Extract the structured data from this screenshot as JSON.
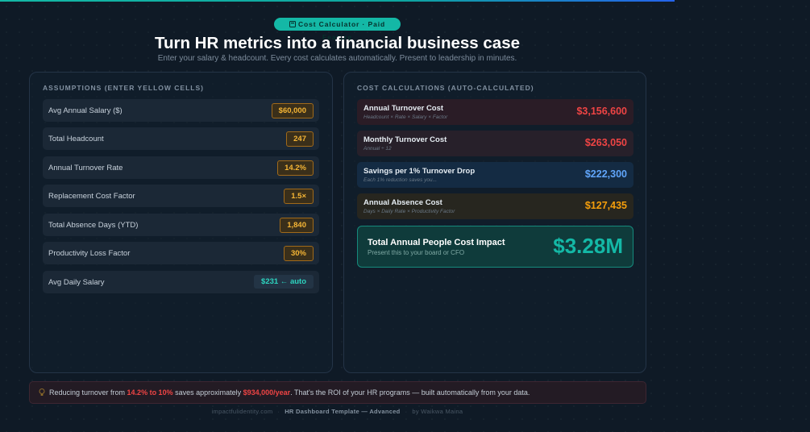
{
  "badge": {
    "icon": "calculator-icon",
    "label": "Cost Calculator · Paid Feature"
  },
  "header": {
    "title": "Turn HR metrics into a financial business case",
    "subtitle": "Enter your salary & headcount. Every cost calculates automatically. Present to leadership in minutes."
  },
  "assumptions": {
    "title": "ASSUMPTIONS (ENTER YELLOW CELLS)",
    "rows": [
      {
        "label": "Avg Annual Salary ($)",
        "value": "$60,000"
      },
      {
        "label": "Total Headcount",
        "value": "247"
      },
      {
        "label": "Annual Turnover Rate",
        "value": "14.2%"
      },
      {
        "label": "Replacement Cost Factor",
        "value": "1.5×"
      },
      {
        "label": "Total Absence Days (YTD)",
        "value": "1,840"
      },
      {
        "label": "Productivity Loss Factor",
        "value": "30%"
      },
      {
        "label": "Avg Daily Salary",
        "value": "$231 ← auto"
      }
    ]
  },
  "calculations": {
    "title": "COST CALCULATIONS (AUTO-CALCULATED)",
    "rows": [
      {
        "title": "Annual Turnover Cost",
        "sub": "Headcount × Rate × Salary × Factor",
        "value": "$3,156,600",
        "color": "#ef4444"
      },
      {
        "title": "Monthly Turnover Cost",
        "sub": "Annual ÷ 12",
        "value": "$263,050",
        "color": "#ef4444"
      },
      {
        "title": "Savings per 1% Turnover Drop",
        "sub": "Each 1% reduction saves you...",
        "value": "$222,300",
        "color": "#60a5fa"
      },
      {
        "title": "Annual Absence Cost",
        "sub": "Days × Daily Rate × Productivity Factor",
        "value": "$127,435",
        "color": "#f59e0b"
      }
    ],
    "total": {
      "title": "Total Annual People Cost Impact",
      "sub": "Present this to your board or CFO",
      "value": "$3.28M"
    }
  },
  "banner": {
    "icon": "lightbulb-icon",
    "prefix": "Reducing turnover from ",
    "range": "14.2% to 10%",
    "middle": " saves approximately ",
    "amount": "$934,000/year",
    "suffix": ". That's the ROI of your HR programs — built automatically from your data."
  },
  "footer": {
    "site": "impactfulidentity.com",
    "product": "HR Dashboard Template — Advanced",
    "author": "by Waikwa Maina"
  },
  "colors": {
    "accent": "#14b8a6",
    "input": "#f5b535",
    "negative": "#ef4444",
    "info": "#60a5fa"
  }
}
